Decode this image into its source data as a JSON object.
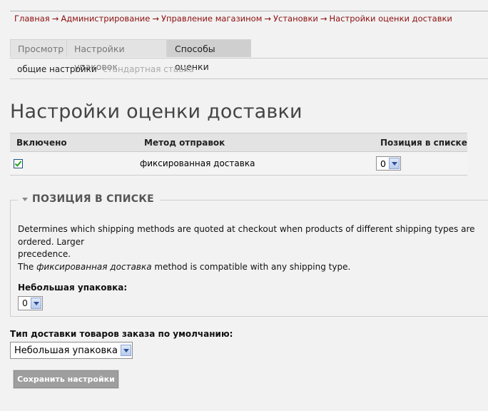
{
  "breadcrumb": [
    "Главная",
    "Администрирование",
    "Управление магазином",
    "Установки",
    "Настройки оценки доставки"
  ],
  "breadcrumb_separator": "→",
  "tabs": [
    {
      "label": "Просмотр"
    },
    {
      "label": "Настройки упаковок"
    },
    {
      "label": "Способы оценки",
      "active": true
    }
  ],
  "subtabs": [
    {
      "label": "общие настройки",
      "active": true
    },
    {
      "label": "стандартная ставка"
    }
  ],
  "page_title": "Настройки оценки доставки",
  "methods_table": {
    "headers": [
      "Включено",
      "Метод отправок",
      "Позиция в списке"
    ],
    "rows": [
      {
        "enabled": true,
        "method": "фиксированная доставка",
        "position": "0"
      }
    ]
  },
  "fieldset": {
    "legend": "ПОЗИЦИЯ В СПИСКЕ",
    "desc_line1": "Determines which shipping methods are quoted at checkout when products of different shipping types are ordered. Larger",
    "desc_line2": "precedence.",
    "desc_line3_pre": "The ",
    "desc_line3_em": "фиксированная доставка",
    "desc_line3_post": " method is compatible with any shipping type.",
    "field_label": "Небольшая упаковка:",
    "field_value": "0"
  },
  "default_type": {
    "label": "Тип доставки товаров заказа по умолчанию:",
    "value": "Небольшая упаковка"
  },
  "save_button": "Сохранить настройки",
  "colors": {
    "link": "#8c0e0e",
    "check": "#21a121",
    "button": "#9e9e9e"
  }
}
